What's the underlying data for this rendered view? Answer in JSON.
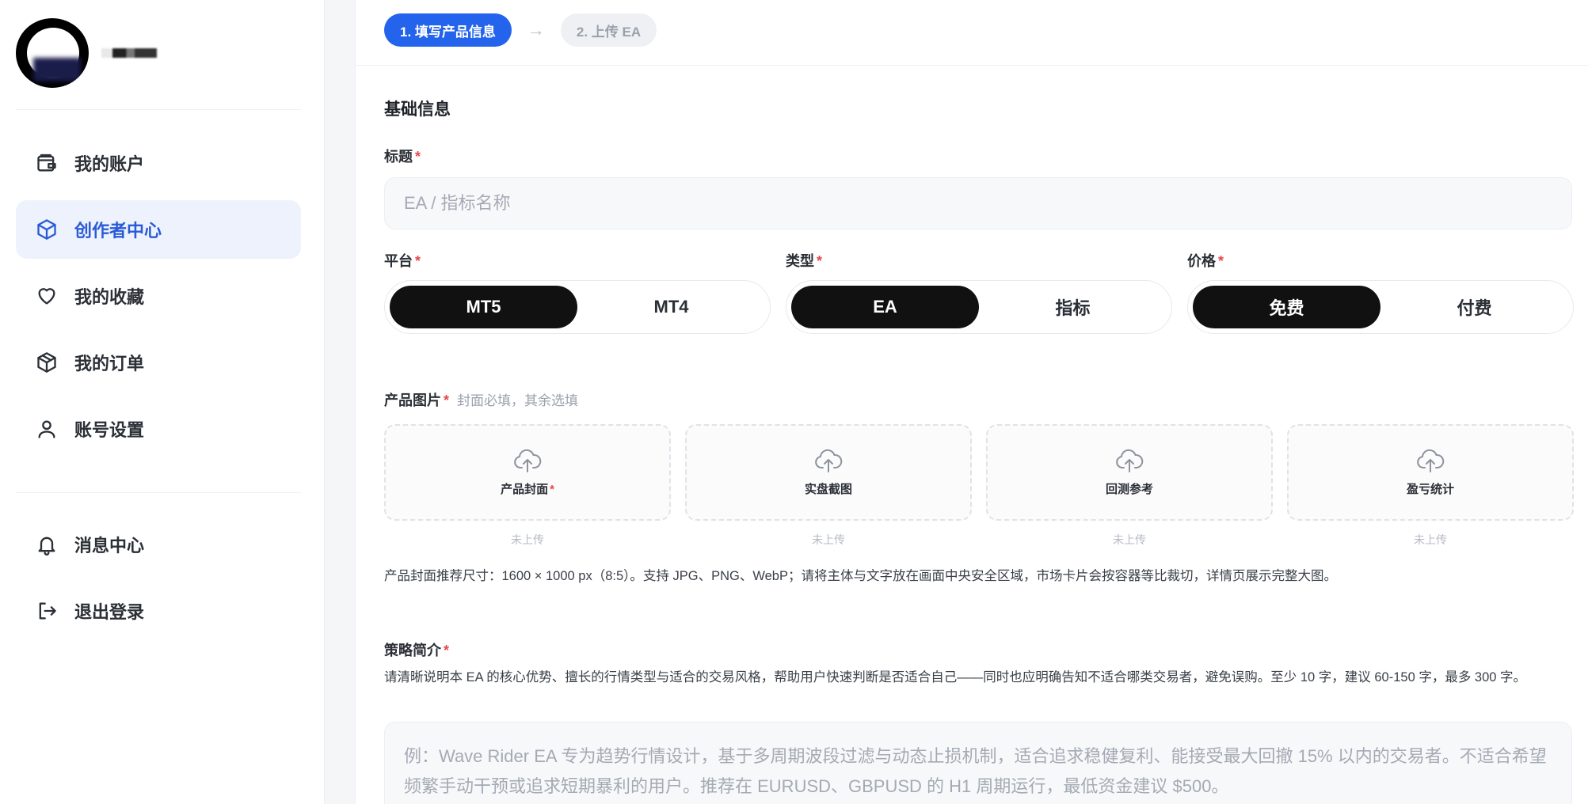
{
  "sidebar": {
    "user_name": "-",
    "nav_main": [
      {
        "label": "我的账户",
        "icon": "wallet-icon",
        "active": false
      },
      {
        "label": "创作者中心",
        "icon": "cube-icon",
        "active": true
      },
      {
        "label": "我的收藏",
        "icon": "heart-icon",
        "active": false
      },
      {
        "label": "我的订单",
        "icon": "package-icon",
        "active": false
      },
      {
        "label": "账号设置",
        "icon": "user-icon",
        "active": false
      }
    ],
    "nav_secondary": [
      {
        "label": "消息中心",
        "icon": "bell-icon"
      },
      {
        "label": "退出登录",
        "icon": "logout-icon"
      }
    ],
    "active_color": "#2a5bd7"
  },
  "steps": [
    {
      "label": "1. 填写产品信息",
      "active": true
    },
    {
      "label": "2. 上传 EA",
      "active": false
    }
  ],
  "form": {
    "section_title": "基础信息",
    "title_field": {
      "label": "标题",
      "required_mark": "*",
      "placeholder": "EA / 指标名称",
      "value": ""
    },
    "platform": {
      "label": "平台",
      "required_mark": "*",
      "options": [
        "MT5",
        "MT4"
      ],
      "selected": "MT5"
    },
    "type": {
      "label": "类型",
      "required_mark": "*",
      "options": [
        "EA",
        "指标"
      ],
      "selected": "EA"
    },
    "price": {
      "label": "价格",
      "required_mark": "*",
      "options": [
        "免费",
        "付费"
      ],
      "selected": "免费"
    },
    "images": {
      "label": "产品图片",
      "required_mark": "*",
      "hint": "封面必填，其余选填",
      "slots": [
        {
          "label": "产品封面",
          "required_mark": "*",
          "status": "未上传"
        },
        {
          "label": "实盘截图",
          "status": "未上传"
        },
        {
          "label": "回测参考",
          "status": "未上传"
        },
        {
          "label": "盈亏统计",
          "status": "未上传"
        }
      ],
      "cover_note": "产品封面推荐尺寸：1600 × 1000 px（8:5）。支持 JPG、PNG、WebP；请将主体与文字放在画面中央安全区域，市场卡片会按容器等比裁切，详情页展示完整大图。"
    },
    "description": {
      "label": "策略简介",
      "required_mark": "*",
      "help": "请清晰说明本 EA 的核心优势、擅长的行情类型与适合的交易风格，帮助用户快速判断是否适合自己——同时也应明确告知不适合哪类交易者，避免误购。至少 10 字，建议 60-150 字，最多 300 字。",
      "placeholder": "例：Wave Rider EA 专为趋势行情设计，基于多周期波段过滤与动态止损机制，适合追求稳健复利、能接受最大回撤 15% 以内的交易者。不适合希望频繁手动干预或追求短期暴利的用户。推荐在 EURUSD、GBPUSD 的 H1 周期运行，最低资金建议 $500。",
      "value": ""
    }
  },
  "colors": {
    "primary": "#2463eb",
    "required": "#e5484d",
    "segment_selected": "#111111"
  }
}
